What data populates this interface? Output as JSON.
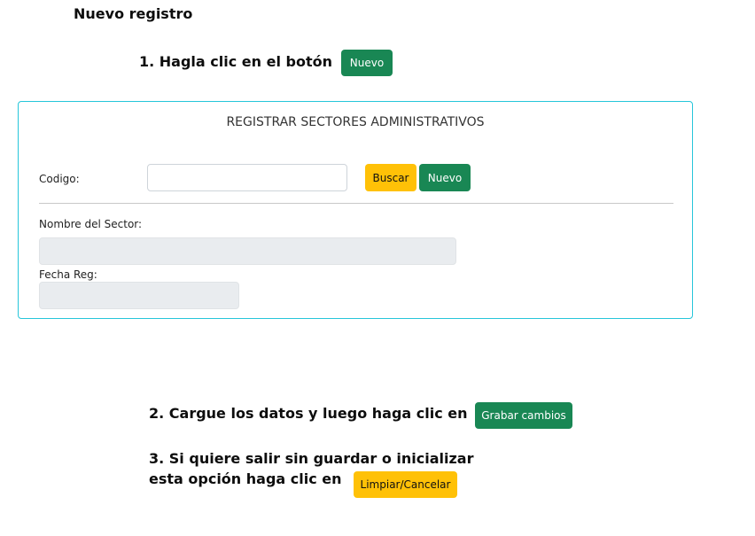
{
  "page_title": "Nuevo registro",
  "steps": {
    "step1_text": "1. Hagla clic en el botón",
    "step1_button": "Nuevo",
    "step2_text": "2. Cargue los datos y luego haga clic en",
    "step2_button": "Grabar cambios",
    "step3_line1": "3.  Si quiere salir sin guardar o inicializar",
    "step3_line2": "esta opción haga clic en",
    "step3_button": "Limpiar/Cancelar"
  },
  "form": {
    "title": "REGISTRAR SECTORES ADMINISTRATIVOS",
    "codigo_label": "Codigo:",
    "codigo_value": "",
    "buscar_button": "Buscar",
    "nuevo_button": "Nuevo",
    "nombre_label": "Nombre del Sector:",
    "nombre_value": "",
    "fecha_label": "Fecha Reg:",
    "fecha_value": ""
  },
  "colors": {
    "green": "#198754",
    "yellow": "#ffc107",
    "card_border": "#26c6da",
    "disabled_field": "#e9ecef"
  }
}
